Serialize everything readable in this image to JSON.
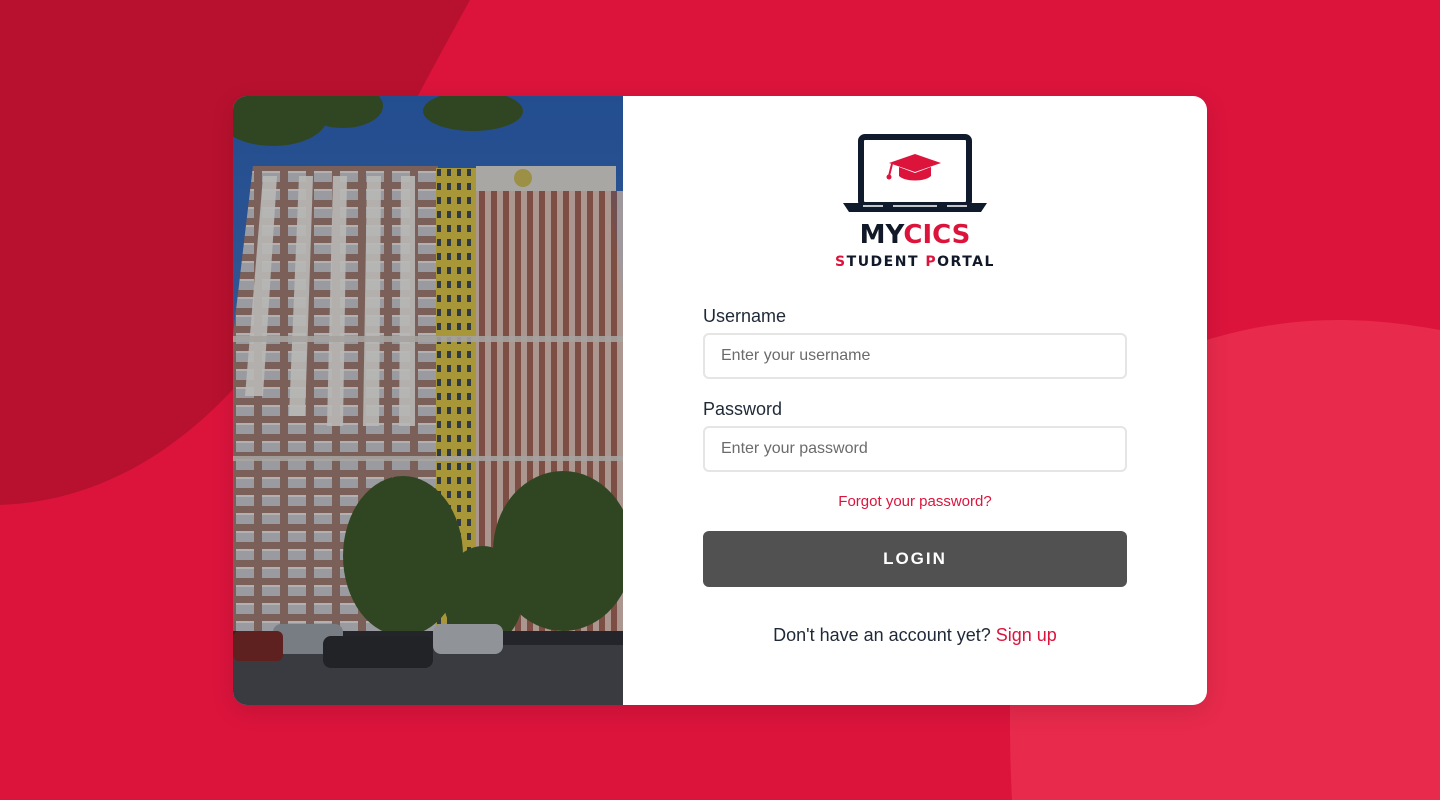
{
  "colors": {
    "background": "#dc143c",
    "accent": "#dc143c",
    "button": "#515151",
    "text": "#1f2937"
  },
  "hero_image": {
    "icon": "building-photo"
  },
  "logo": {
    "icon": "laptop-graduation-cap-icon",
    "title_part1": "MY",
    "title_part2": "CICS",
    "subtitle_s": "S",
    "subtitle_mid": "TUDENT ",
    "subtitle_p": "P",
    "subtitle_end": "ORTAL"
  },
  "form": {
    "username_label": "Username",
    "username_placeholder": "Enter your username",
    "username_value": "",
    "password_label": "Password",
    "password_placeholder": "Enter your password",
    "password_value": "",
    "forgot_link": "Forgot your password?",
    "login_button": "LOGIN",
    "signup_prompt": "Don't have an account yet?",
    "signup_link": "Sign up"
  }
}
